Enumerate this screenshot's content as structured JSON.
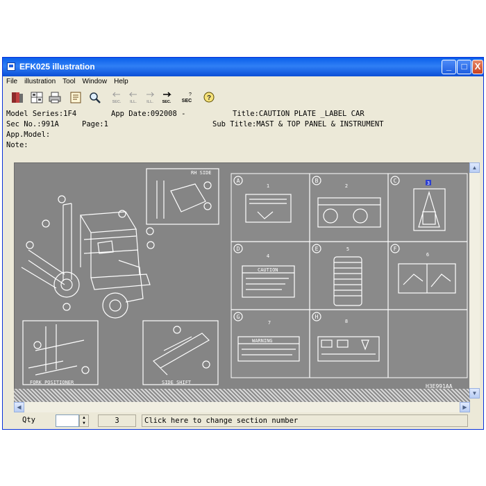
{
  "window": {
    "title": "EFK025 illustration",
    "buttons": {
      "minimize": "_",
      "maximize": "□",
      "close": "X"
    }
  },
  "menu": [
    "File",
    "illustration",
    "Tool",
    "Window",
    "Help"
  ],
  "toolbar": {
    "icons": [
      "book-icon",
      "grid-icon",
      "print-icon",
      "page-icon",
      "search-icon",
      "prev-section-icon",
      "prev-illustration-icon",
      "next-illustration-icon",
      "next-section-icon",
      "section-query-icon",
      "help-icon"
    ],
    "labels": {
      "prev_sec": "SEC.",
      "prev_ill": "ILL.",
      "next_ill": "ILL.",
      "next_sec": "SEC.",
      "sec_query": "SEC"
    }
  },
  "info": {
    "model_series": "Model Series:1F4",
    "app_date": "App Date:092008 -",
    "title": "Title:CAUTION PLATE _LABEL CAR",
    "sec_no": "Sec No.:991A",
    "page": "Page:1",
    "sub_title": "Sub Title:MAST & TOP PANEL & INSTRUMENT",
    "app_model": "App.Model:",
    "note": "Note:"
  },
  "illustration": {
    "code": "H3E991AA",
    "rh_side": "RH SIDE",
    "fork_positioner": "FORK POSITIONER",
    "side_shift": "SIDE SHIFT",
    "cells": [
      {
        "letter": "A",
        "number": "1"
      },
      {
        "letter": "B",
        "number": "2"
      },
      {
        "letter": "C",
        "number": "3"
      },
      {
        "letter": "D",
        "number": "4"
      },
      {
        "letter": "E",
        "number": "5"
      },
      {
        "letter": "F",
        "number": "6"
      },
      {
        "letter": "G",
        "number": "7"
      },
      {
        "letter": "H",
        "number": "8"
      }
    ],
    "caution": "CAUTION",
    "warning": "WARNING"
  },
  "status": {
    "qty_label": "Qty",
    "qty_value": "",
    "page_number": "3",
    "section_hint": "Click here to change section number"
  }
}
